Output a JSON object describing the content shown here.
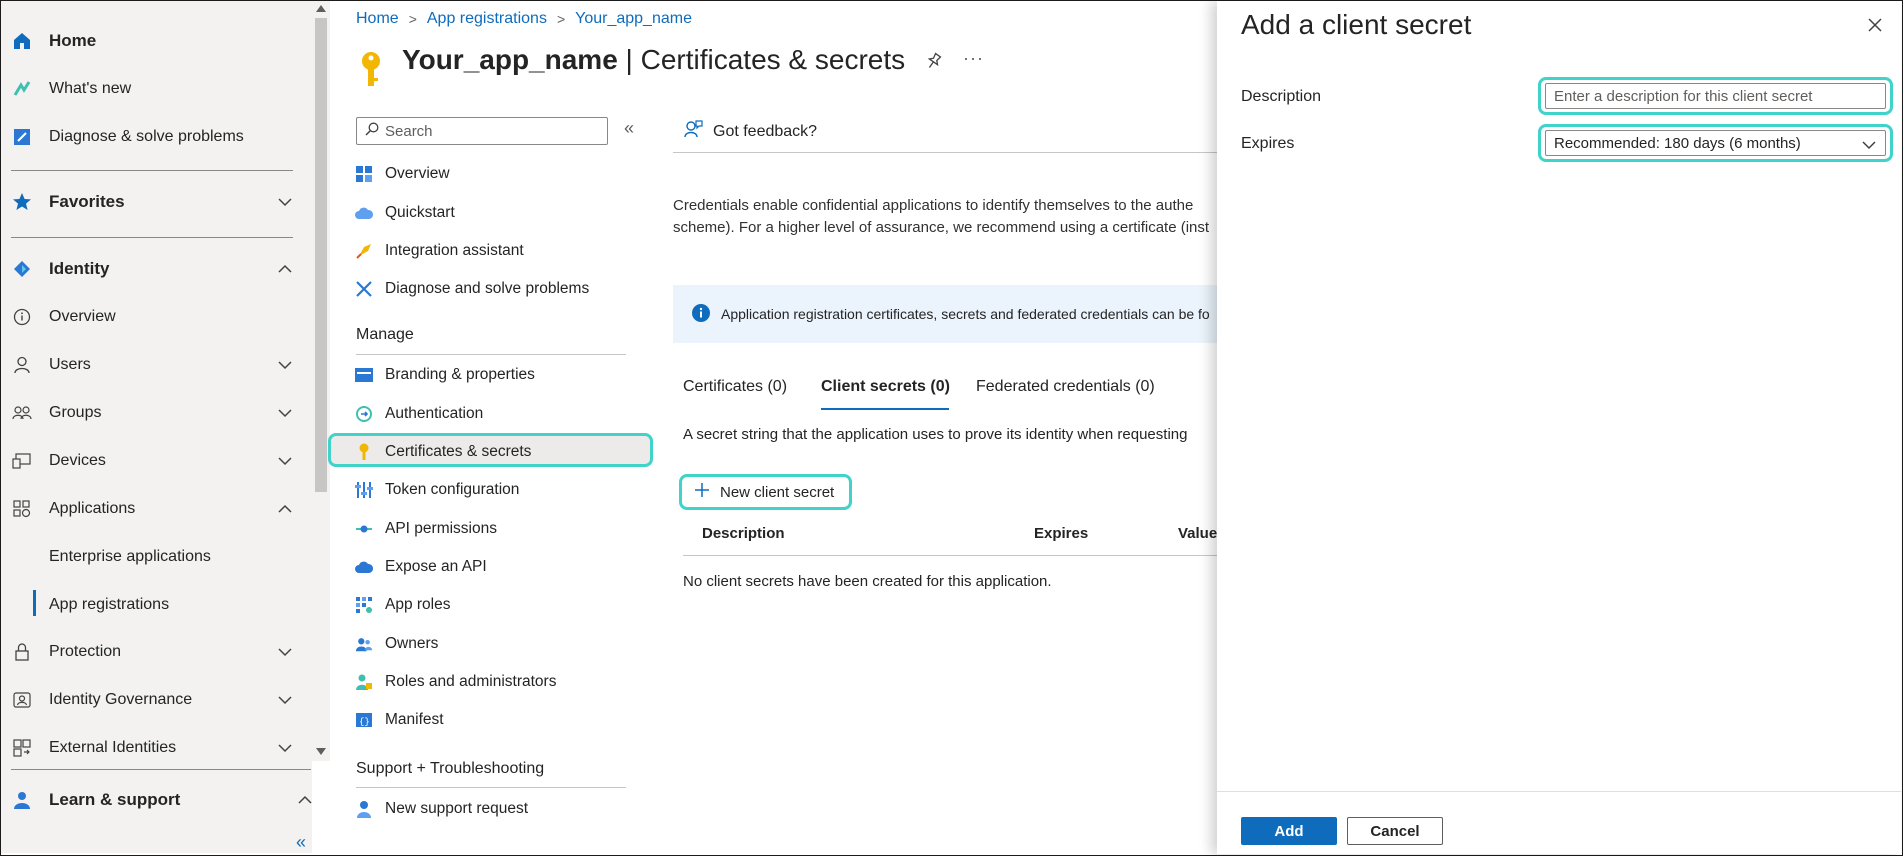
{
  "leftnav": {
    "home": "Home",
    "whats_new": "What's new",
    "diagnose": "Diagnose & solve problems",
    "favorites": "Favorites",
    "identity": "Identity",
    "overview": "Overview",
    "users": "Users",
    "groups": "Groups",
    "devices": "Devices",
    "applications": "Applications",
    "enterprise_apps": "Enterprise applications",
    "app_registrations": "App registrations",
    "protection": "Protection",
    "identity_governance": "Identity Governance",
    "external_identities": "External Identities",
    "learn_support": "Learn & support",
    "collapse": "«"
  },
  "breadcrumb": [
    "Home",
    "App registrations",
    "Your_app_name"
  ],
  "page": {
    "app_name": "Your_app_name",
    "section": " | Certificates & secrets",
    "more": "···"
  },
  "search": {
    "placeholder": "Search",
    "collapse": "«"
  },
  "menu": {
    "overview": "Overview",
    "quickstart": "Quickstart",
    "integration": "Integration assistant",
    "diagnose": "Diagnose and solve problems",
    "manage_header": "Manage",
    "branding": "Branding & properties",
    "authentication": "Authentication",
    "certs": "Certificates & secrets",
    "token": "Token configuration",
    "api_perms": "API permissions",
    "expose_api": "Expose an API",
    "app_roles": "App roles",
    "owners": "Owners",
    "roles_admins": "Roles and administrators",
    "manifest": "Manifest",
    "support_header": "Support + Troubleshooting",
    "new_support": "New support request"
  },
  "content": {
    "feedback": "Got feedback?",
    "desc_line1": "Credentials enable confidential applications to identify themselves to the authe",
    "desc_line2": "scheme). For a higher level of assurance, we recommend using a certificate (inst",
    "info": "Application registration certificates, secrets and federated credentials can be fo",
    "tabs": [
      "Certificates (0)",
      "Client secrets (0)",
      "Federated credentials (0)"
    ],
    "tab_desc": "A secret string that the application uses to prove its identity when requesting",
    "new_secret": "New client secret",
    "table_headers": [
      "Description",
      "Expires",
      "Value"
    ],
    "empty": "No client secrets have been created for this application."
  },
  "panel": {
    "title": "Add a client secret",
    "description_label": "Description",
    "description_placeholder": "Enter a description for this client secret",
    "expires_label": "Expires",
    "expires_value": "Recommended: 180 days (6 months)",
    "add": "Add",
    "cancel": "Cancel"
  },
  "colors": {
    "accent": "#0f6cbd",
    "highlight": "#3fd3c9"
  }
}
